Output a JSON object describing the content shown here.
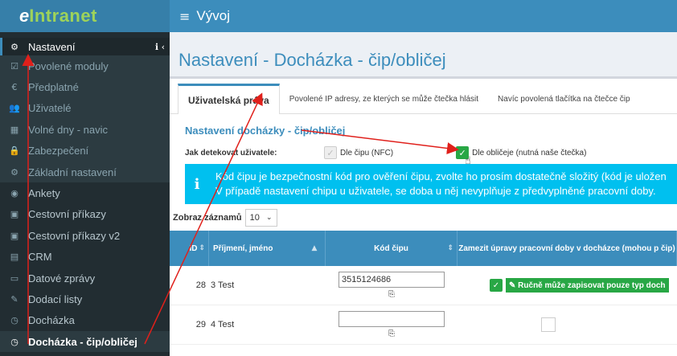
{
  "brand": {
    "prefix": "e",
    "name": "Intranet"
  },
  "header": {
    "menu_icon": "≡",
    "title": "Vývoj"
  },
  "sidebar": {
    "head": {
      "label": "Nastavení"
    },
    "items": [
      {
        "label": "Povolené moduly",
        "icon": "check-square-icon",
        "glyph": "☑"
      },
      {
        "label": "Předplatné",
        "icon": "euro-icon",
        "glyph": "€"
      },
      {
        "label": "Uživatelé",
        "icon": "users-icon",
        "glyph": "👥"
      },
      {
        "label": "Volné dny - navic",
        "icon": "calendar-icon",
        "glyph": "▦"
      },
      {
        "label": "Zabezpečení",
        "icon": "lock-icon",
        "glyph": "🔒"
      },
      {
        "label": "Základní nastavení",
        "icon": "gears-icon",
        "glyph": "⚙"
      },
      {
        "label": "Ankety",
        "icon": "dot-icon",
        "glyph": "◉"
      },
      {
        "label": "Cestovní příkazy",
        "icon": "car-icon",
        "glyph": "▣"
      },
      {
        "label": "Cestovní příkazy v2",
        "icon": "car-icon",
        "glyph": "▣"
      },
      {
        "label": "CRM",
        "icon": "building-icon",
        "glyph": "▤"
      },
      {
        "label": "Datové zprávy",
        "icon": "inbox-icon",
        "glyph": "▭"
      },
      {
        "label": "Dodací listy",
        "icon": "edit-icon",
        "glyph": "✎"
      },
      {
        "label": "Docházka",
        "icon": "clock-icon",
        "glyph": "◷"
      }
    ],
    "active": {
      "label": "Docházka - čip/obličej",
      "icon": "clock-icon",
      "glyph": "◷"
    }
  },
  "page_title": "Nastavení - Docházka - čip/obličej",
  "tabs": [
    {
      "label": "Uživatelská práva"
    },
    {
      "label": "Povolené IP adresy, ze kterých se může čtečka hlásit"
    },
    {
      "label": "Navíc povolená tlačítka na čtečce čip"
    }
  ],
  "section_title": "Nastavení docházky - čip/obličej",
  "detect": {
    "label": "Jak detekovat uživatele:",
    "opt1": "Dle čipu (NFC)",
    "opt2": "Dle obličeje (nutná naše čtečka)"
  },
  "info": {
    "line1": "Kód čipu je bezpečnostní kód pro ověření čipu, zvolte ho prosím dostatečně složitý (kód je uložen",
    "line2": "V případě nastavení chipu u uživatele, se doba u něj nevyplňuje z předvyplněné pracovní doby."
  },
  "show_entries": {
    "label": "Zobraz záznamů",
    "value": "10"
  },
  "table": {
    "headers": {
      "id": "ID",
      "name": "Příjmení, jméno",
      "code": "Kód čipu",
      "opt": "Zamezit úpravy pracovní doby v docházce (mohou p čip)"
    },
    "rows": [
      {
        "id": "28",
        "name": "3 Test",
        "code": "3515124686",
        "note": "Ručně může zapisovat pouze typ doch"
      },
      {
        "id": "29",
        "name": "4 Test",
        "code": "",
        "note": ""
      }
    ]
  },
  "colors": {
    "accent": "#3c8dbc",
    "sidebar": "#222d32",
    "info": "#00c0ef",
    "success": "#28a745",
    "arrow": "#e0201b"
  }
}
